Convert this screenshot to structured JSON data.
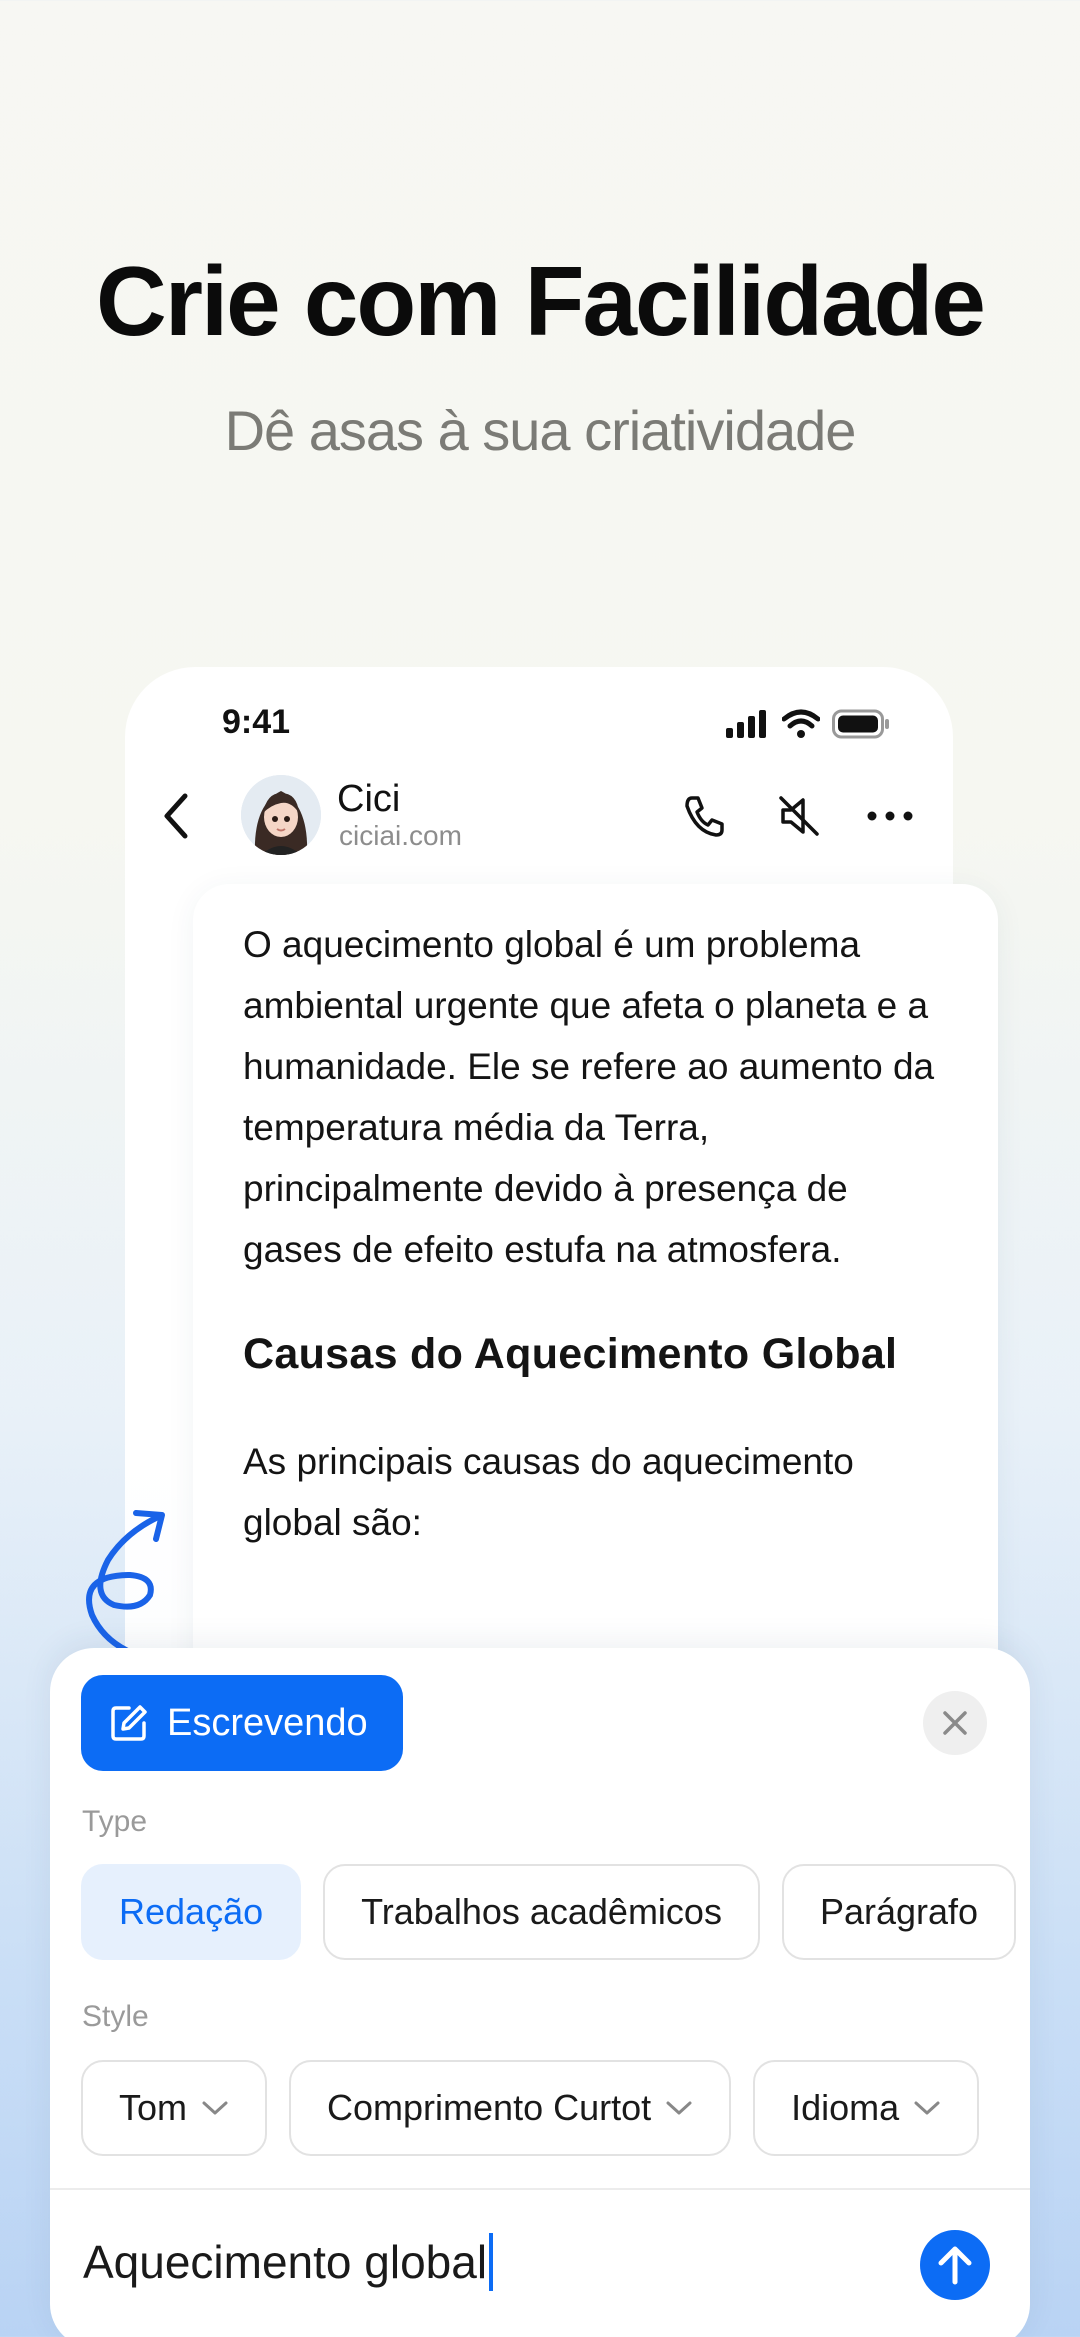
{
  "headline": "Crie com Facilidade",
  "subheadline": "Dê asas à sua criatividade",
  "status_bar": {
    "time": "9:41"
  },
  "chat_header": {
    "name": "Cici",
    "domain": "ciciai.com"
  },
  "message": {
    "paragraph1": "O aquecimento global é um problema ambiental urgente que afeta o planeta e a humanidade. Ele se refere ao aumento da temperatura média da Terra, principalmente devido à presença de gases de efeito estufa na atmosfera.",
    "section_title": "Causas do Aquecimento Global",
    "paragraph2": "As principais causas do aquecimento global são:"
  },
  "panel": {
    "mode_label": "Escrevendo",
    "type_label": "Type",
    "type_options": [
      "Redação",
      "Trabalhos acadêmicos",
      "Parágrafo"
    ],
    "selected_type": "Redação",
    "style_label": "Style",
    "style_options": [
      "Tom",
      "Comprimento Curtot",
      "Idioma"
    ],
    "input_value": "Aquecimento global"
  },
  "colors": {
    "accent": "#0c6cf5",
    "chip_selected_bg": "#e6f0fd",
    "muted_text": "#9a9a9a"
  }
}
